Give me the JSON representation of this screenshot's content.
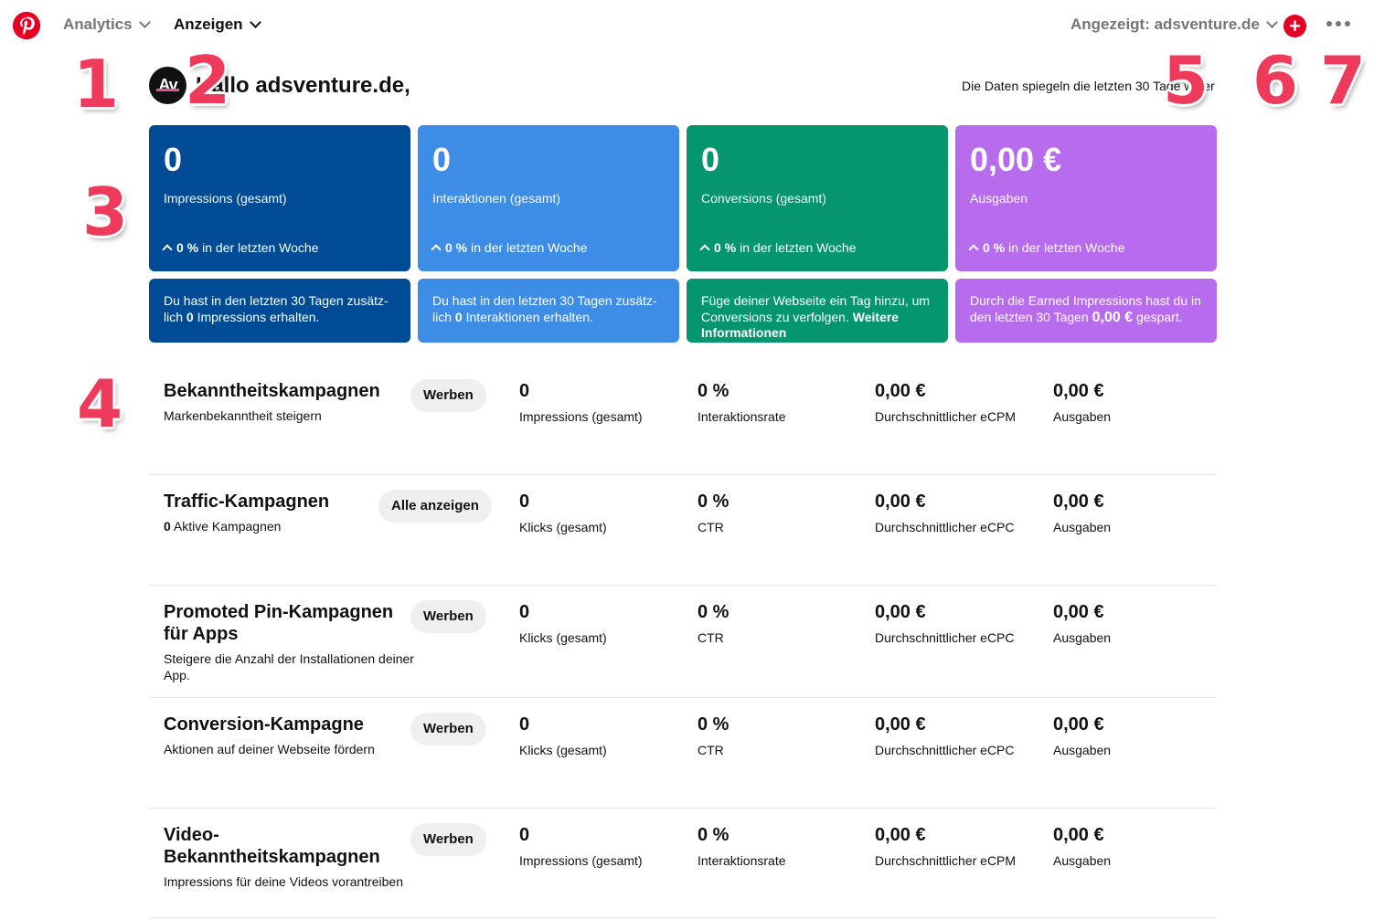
{
  "nav": {
    "analytics": "Analytics",
    "ads": "Anzeigen",
    "account": "Angezeigt: adsventure.de"
  },
  "header": {
    "avatar_text": "Av",
    "greeting": "Hallo adsventure.de,",
    "data_note": "Die Daten spiegeln die letzten 30 Tage wider"
  },
  "annotations": [
    "1",
    "2",
    "3",
    "4",
    "5",
    "6",
    "7"
  ],
  "colors": {
    "brand": "#e60023",
    "card_impressions": "#004b96",
    "card_interactions": "#3d8ce6",
    "card_conversions": "#05956f",
    "card_spend": "#b76ced",
    "annotation": "#ef3b5b"
  },
  "cards": [
    {
      "value": "0",
      "label": "Impressions (gesamt)",
      "trend_value": "0 %",
      "trend_text": "in der letzten Woche",
      "info_pre": "Du hast in den letzten 30 Tagen zusätz-lich",
      "info_bold": "0",
      "info_post": "Impressions erhalten."
    },
    {
      "value": "0",
      "label": "Interaktionen (gesamt)",
      "trend_value": "0 %",
      "trend_text": "in der letzten Woche",
      "info_pre": "Du hast in den letzten 30 Tagen zusätz-lich",
      "info_bold": "0",
      "info_post": "Interaktionen erhalten."
    },
    {
      "value": "0",
      "label": "Conversions (gesamt)",
      "trend_value": "0 %",
      "trend_text": "in der letzten Woche",
      "info_pre": "Füge deiner Webseite ein Tag hinzu, um Conversions zu verfolgen.",
      "info_bold": "Weitere Informationen",
      "info_post": ""
    },
    {
      "value": "0,00 €",
      "label": "Ausgaben",
      "trend_value": "0 %",
      "trend_text": "in der letzten Woche",
      "info_pre": "Durch die Earned Impressions hast du in den letzten 30 Tagen",
      "info_bold": "0,00 €",
      "info_post": "gespart."
    }
  ],
  "campaigns": [
    {
      "title": "Bekanntheitskampagnen",
      "subtitle": "Markenbekanntheit steigern",
      "subtitle_bold": "",
      "button": "Werben",
      "metrics": [
        {
          "value": "0",
          "label": "Impressions (gesamt)"
        },
        {
          "value": "0 %",
          "label": "Interaktionsrate"
        },
        {
          "value": "0,00 €",
          "label": "Durchschnittlicher eCPM"
        },
        {
          "value": "0,00 €",
          "label": "Ausgaben"
        }
      ]
    },
    {
      "title": "Traffic-Kampagnen",
      "subtitle": "Aktive Kampagnen",
      "subtitle_bold": "0",
      "button": "Alle anzeigen",
      "metrics": [
        {
          "value": "0",
          "label": "Klicks (gesamt)"
        },
        {
          "value": "0 %",
          "label": "CTR"
        },
        {
          "value": "0,00 €",
          "label": "Durchschnittlicher eCPC"
        },
        {
          "value": "0,00 €",
          "label": "Ausgaben"
        }
      ]
    },
    {
      "title": "Promoted Pin-Kampagnen für Apps",
      "subtitle": "Steigere die Anzahl der Installationen deiner App.",
      "subtitle_bold": "",
      "button": "Werben",
      "metrics": [
        {
          "value": "0",
          "label": "Klicks (gesamt)"
        },
        {
          "value": "0 %",
          "label": "CTR"
        },
        {
          "value": "0,00 €",
          "label": "Durchschnittlicher eCPC"
        },
        {
          "value": "0,00 €",
          "label": "Ausgaben"
        }
      ]
    },
    {
      "title": "Conversion-Kampagne",
      "subtitle": "Aktionen auf deiner Webseite fördern",
      "subtitle_bold": "",
      "button": "Werben",
      "metrics": [
        {
          "value": "0",
          "label": "Klicks (gesamt)"
        },
        {
          "value": "0 %",
          "label": "CTR"
        },
        {
          "value": "0,00 €",
          "label": "Durchschnittlicher eCPC"
        },
        {
          "value": "0,00 €",
          "label": "Ausgaben"
        }
      ]
    },
    {
      "title": "Video-Bekanntheitskampagnen",
      "subtitle": "Impressions für deine Videos vorantreiben",
      "subtitle_bold": "",
      "button": "Werben",
      "metrics": [
        {
          "value": "0",
          "label": "Impressions (gesamt)"
        },
        {
          "value": "0 %",
          "label": "Interaktionsrate"
        },
        {
          "value": "0,00 €",
          "label": "Durchschnittlicher eCPM"
        },
        {
          "value": "0,00 €",
          "label": "Ausgaben"
        }
      ]
    }
  ]
}
